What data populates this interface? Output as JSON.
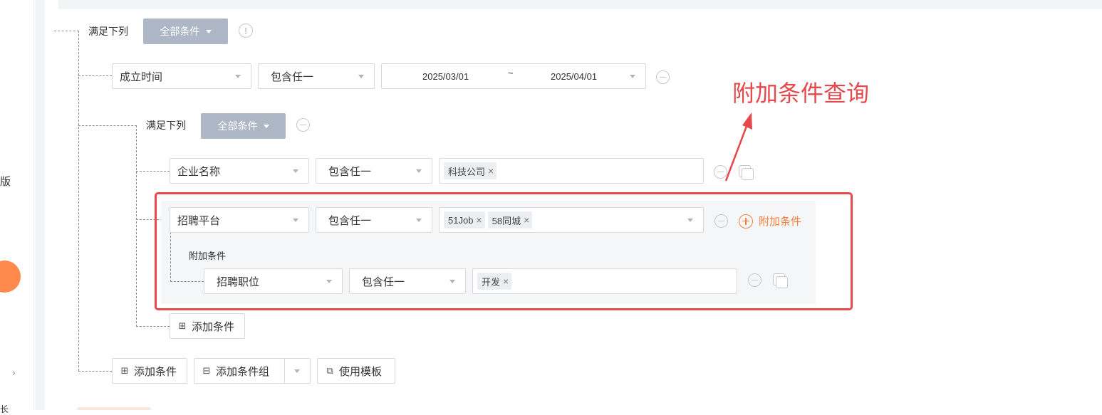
{
  "sidebar": {
    "partial_text": "版",
    "chevron": "›",
    "bottom_fragment": "长"
  },
  "group_root": {
    "label": "满足下列",
    "mode": "全部条件"
  },
  "row_date": {
    "field": "成立时间",
    "operator": "包含任一",
    "start": "2025/03/01",
    "sep": "~",
    "end": "2025/04/01"
  },
  "group_sub": {
    "label": "满足下列",
    "mode": "全部条件"
  },
  "row_company": {
    "field": "企业名称",
    "operator": "包含任一",
    "tags": [
      "科技公司"
    ]
  },
  "row_platform": {
    "field": "招聘平台",
    "operator": "包含任一",
    "tags": [
      "51Job",
      "58同城"
    ],
    "add_label": "附加条件"
  },
  "attached": {
    "title": "附加条件",
    "field": "招聘职位",
    "operator": "包含任一",
    "tags": [
      "开发"
    ]
  },
  "buttons": {
    "add_condition_inner": "添加条件",
    "add_condition": "添加条件",
    "add_group": "添加条件组",
    "use_template": "使用模板"
  },
  "annotation": {
    "text": "附加条件查询",
    "color": "#e5484d"
  },
  "colors": {
    "accent": "#f07f3c",
    "group_button": "#aeb7c5",
    "highlight": "#e5484d"
  },
  "icons": {
    "remove": "minus-circle-icon",
    "copy": "copy-icon",
    "info": "info-icon",
    "add": "plus-circle-icon"
  }
}
